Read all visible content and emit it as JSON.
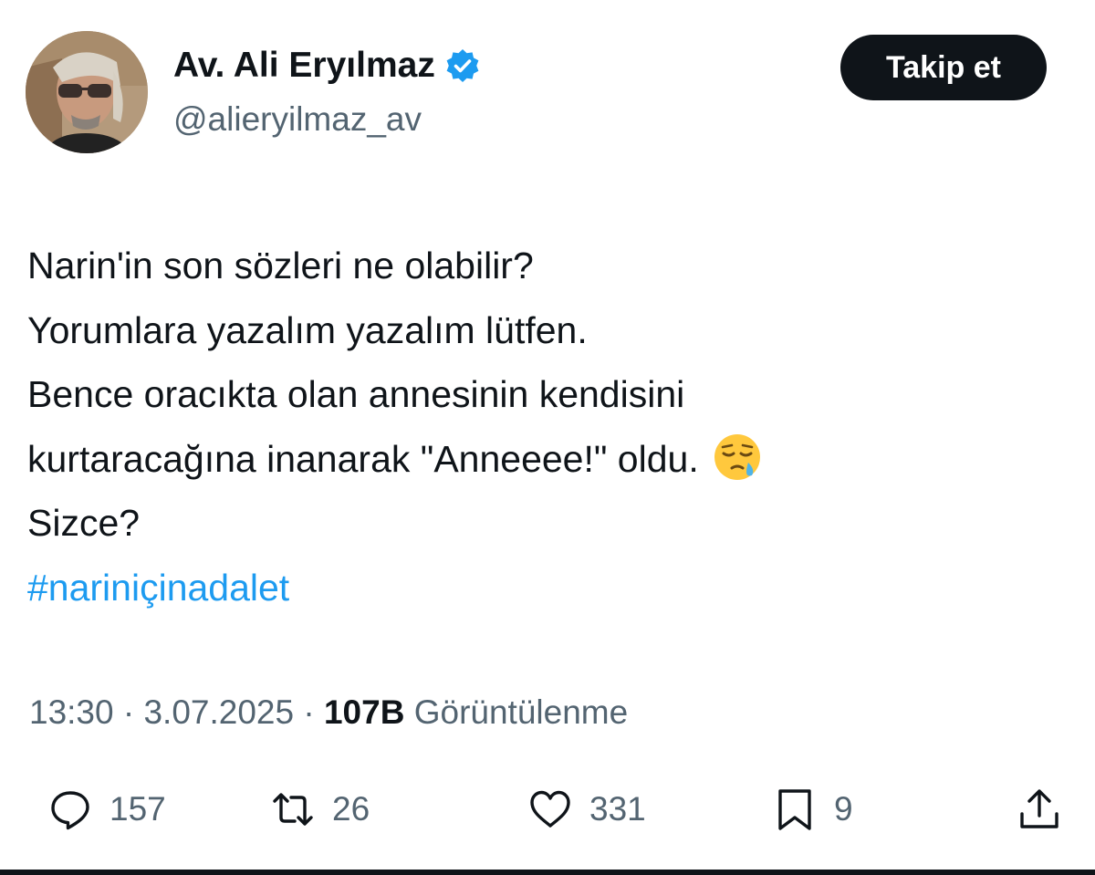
{
  "header": {
    "display_name": "Av. Ali Eryılmaz",
    "handle": "@alieryilmaz_av",
    "follow_label": "Takip et"
  },
  "tweet": {
    "lines": [
      "Narin'in son sözleri ne olabilir?",
      "Yorumlara yazalım yazalım lütfen.",
      "Bence oracıkta olan annesinin kendisini",
      "kurtaracağına inanarak \"Anneeee!\" oldu.",
      "Sizce?"
    ],
    "emoji": "sleepy-face",
    "hashtag": "#nariniçinadalet"
  },
  "meta": {
    "time": "13:30",
    "separator": " · ",
    "date": "3.07.2025",
    "views_count": "107B",
    "views_label": "Görüntülenme"
  },
  "actions": {
    "replies": "157",
    "reposts": "26",
    "likes": "331",
    "bookmarks": "9"
  },
  "colors": {
    "text": "#0f1419",
    "secondary": "#536471",
    "accent": "#1d9bf0",
    "button_bg": "#0f1419"
  }
}
